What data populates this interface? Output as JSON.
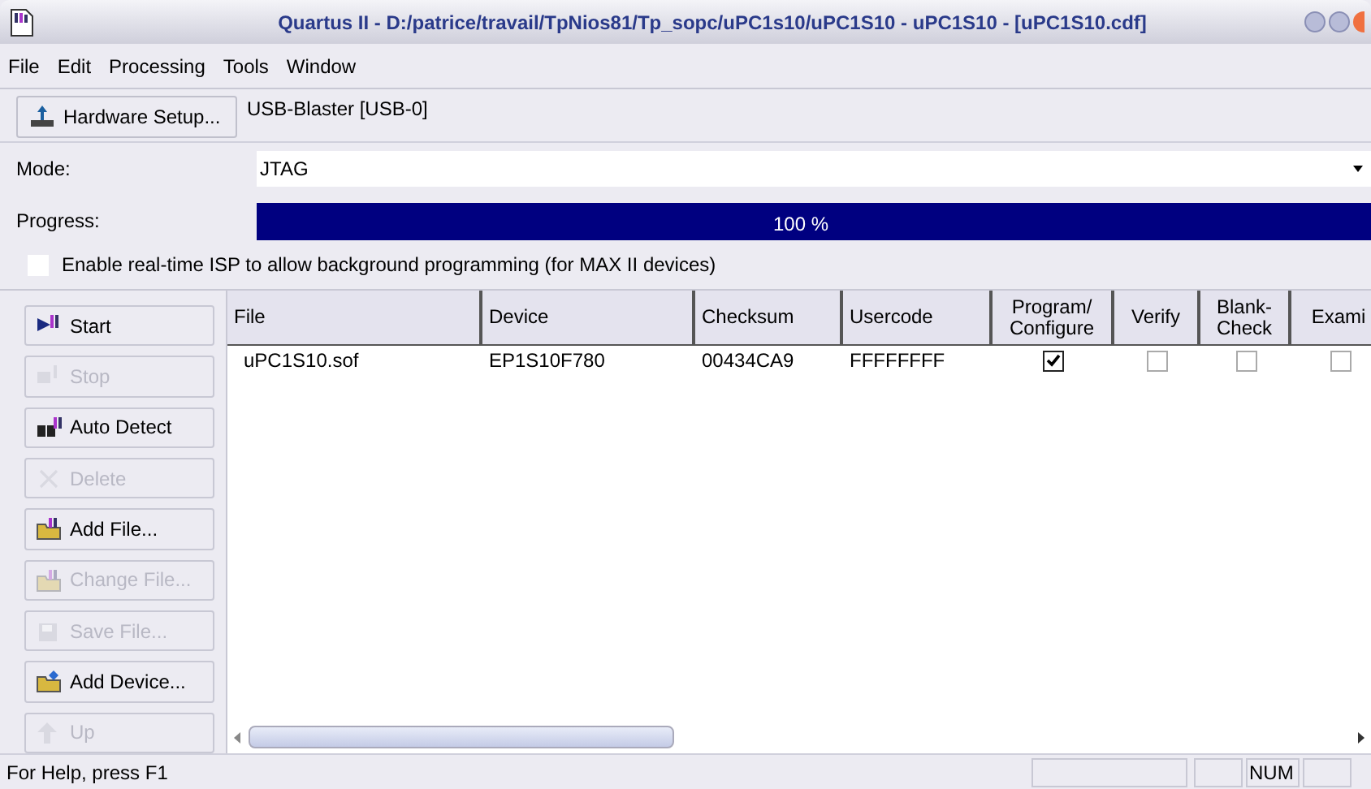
{
  "window": {
    "title": "Quartus II - D:/patrice/travail/TpNios81/Tp_sopc/uPC1s10/uPC1S10 - uPC1S10 - [uPC1S10.cdf]"
  },
  "menu": [
    "File",
    "Edit",
    "Processing",
    "Tools",
    "Window"
  ],
  "hardware": {
    "button": "Hardware Setup...",
    "value": "USB-Blaster [USB-0]"
  },
  "mode": {
    "label": "Mode:",
    "value": "JTAG"
  },
  "progress": {
    "label": "Progress:",
    "level": 1,
    "reading": "100 %"
  },
  "isp_option": {
    "label": "Enable real-time ISP to allow background programming (for MAX II devices)",
    "checked": false
  },
  "buttons": [
    {
      "label": "Start",
      "disabled": false
    },
    {
      "label": "Stop",
      "disabled": true
    },
    {
      "label": "Auto Detect",
      "disabled": false
    },
    {
      "label": "Delete",
      "disabled": true
    },
    {
      "label": "Add File...",
      "disabled": false
    },
    {
      "label": "Change File...",
      "disabled": true
    },
    {
      "label": "Save File...",
      "disabled": true
    },
    {
      "label": "Add Device...",
      "disabled": false
    },
    {
      "label": "Up",
      "disabled": true
    }
  ],
  "table": {
    "columns": [
      "File",
      "Device",
      "Checksum",
      "Usercode",
      "Program/ Configure",
      "Verify",
      "Blank- Check",
      "Exami"
    ],
    "rows": [
      {
        "file": "uPC1S10.sof",
        "device": "EP1S10F780",
        "checksum": "00434CA9",
        "usercode": "FFFFFFFF",
        "program": true,
        "verify": false,
        "blank_check": false,
        "examine": false
      }
    ]
  },
  "status_bar": {
    "help": "For Help, press F1",
    "num": "NUM"
  }
}
